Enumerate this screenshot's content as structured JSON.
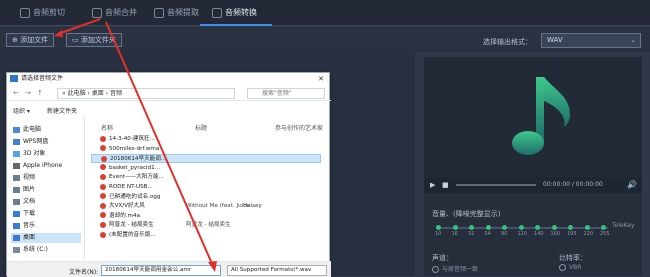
{
  "tabs": [
    {
      "label": "音频剪切"
    },
    {
      "label": "音频合并"
    },
    {
      "label": "音频提取"
    },
    {
      "label": "音频转换"
    }
  ],
  "toolbar": {
    "add_file": "添加文件",
    "add_folder": "添加文件夹",
    "format_label": "选择输出格式：",
    "format_value": "WAV"
  },
  "player": {
    "time": "00:00:00 / 00:00:00",
    "eq_title": "音量、(降噪完整显示)",
    "eq_right": "TeleKey",
    "eq_labels": [
      "10",
      "16",
      "32",
      "54",
      "90",
      "120",
      "140",
      "160",
      "195",
      "220",
      "255"
    ],
    "select_label": "声道：",
    "radio1": "与原音频一致",
    "bitrate_label": "比特率：",
    "radio2": "VBR"
  },
  "dialog": {
    "title": "请选择音频文件",
    "path": "« 此电脑 › 桌面 › 音频",
    "search": "搜索\"音频\"",
    "organize": "组织 ▾",
    "new_folder": "新建文件夹",
    "col_name": "名称",
    "col_title": "标题",
    "col_artist": "参与创作的艺术家",
    "nav": [
      "此电脑",
      "WPS网盘",
      "3D 对象",
      "Apple iPhone",
      "视频",
      "图片",
      "文档",
      "下载",
      "音乐",
      "桌面",
      "系统 (C:)"
    ],
    "files": [
      {
        "name": "14-3-40-建筑狂...",
        "title": "",
        "artist": ""
      },
      {
        "name": "500miles-drf.wma",
        "title": "",
        "artist": ""
      },
      {
        "name": "20180614早天能调...",
        "title": "",
        "artist": ""
      },
      {
        "name": "basket_pyracid1...",
        "title": "",
        "artist": ""
      },
      {
        "name": "Event——大阳万能...",
        "title": "",
        "artist": ""
      },
      {
        "name": "RODE NT-USB...",
        "title": "",
        "artist": ""
      },
      {
        "name": "已耕通吃的试名.ogg",
        "title": "",
        "artist": ""
      },
      {
        "name": "大VX/V好大风",
        "title": "Without Me (feat. Juice ...",
        "artist": "Halsey"
      },
      {
        "name": "退却的.m4a",
        "title": "",
        "artist": ""
      },
      {
        "name": "阿普龙 - 结局卖生",
        "title": "阿普龙 - 结局卖生",
        "artist": ""
      },
      {
        "name": "(未配置的音乐版...",
        "title": "",
        "artist": ""
      }
    ],
    "filename_label": "文件名(N):",
    "filename_value": "20180614早天能调用金会公.amr",
    "filetype_value": "All Supported Formats(*.wav"
  },
  "colors": {
    "accent": "#3e8ce6",
    "arrow": "#e0302a",
    "note_top": "#3ec98a",
    "note_bottom": "#1f6c6c"
  }
}
